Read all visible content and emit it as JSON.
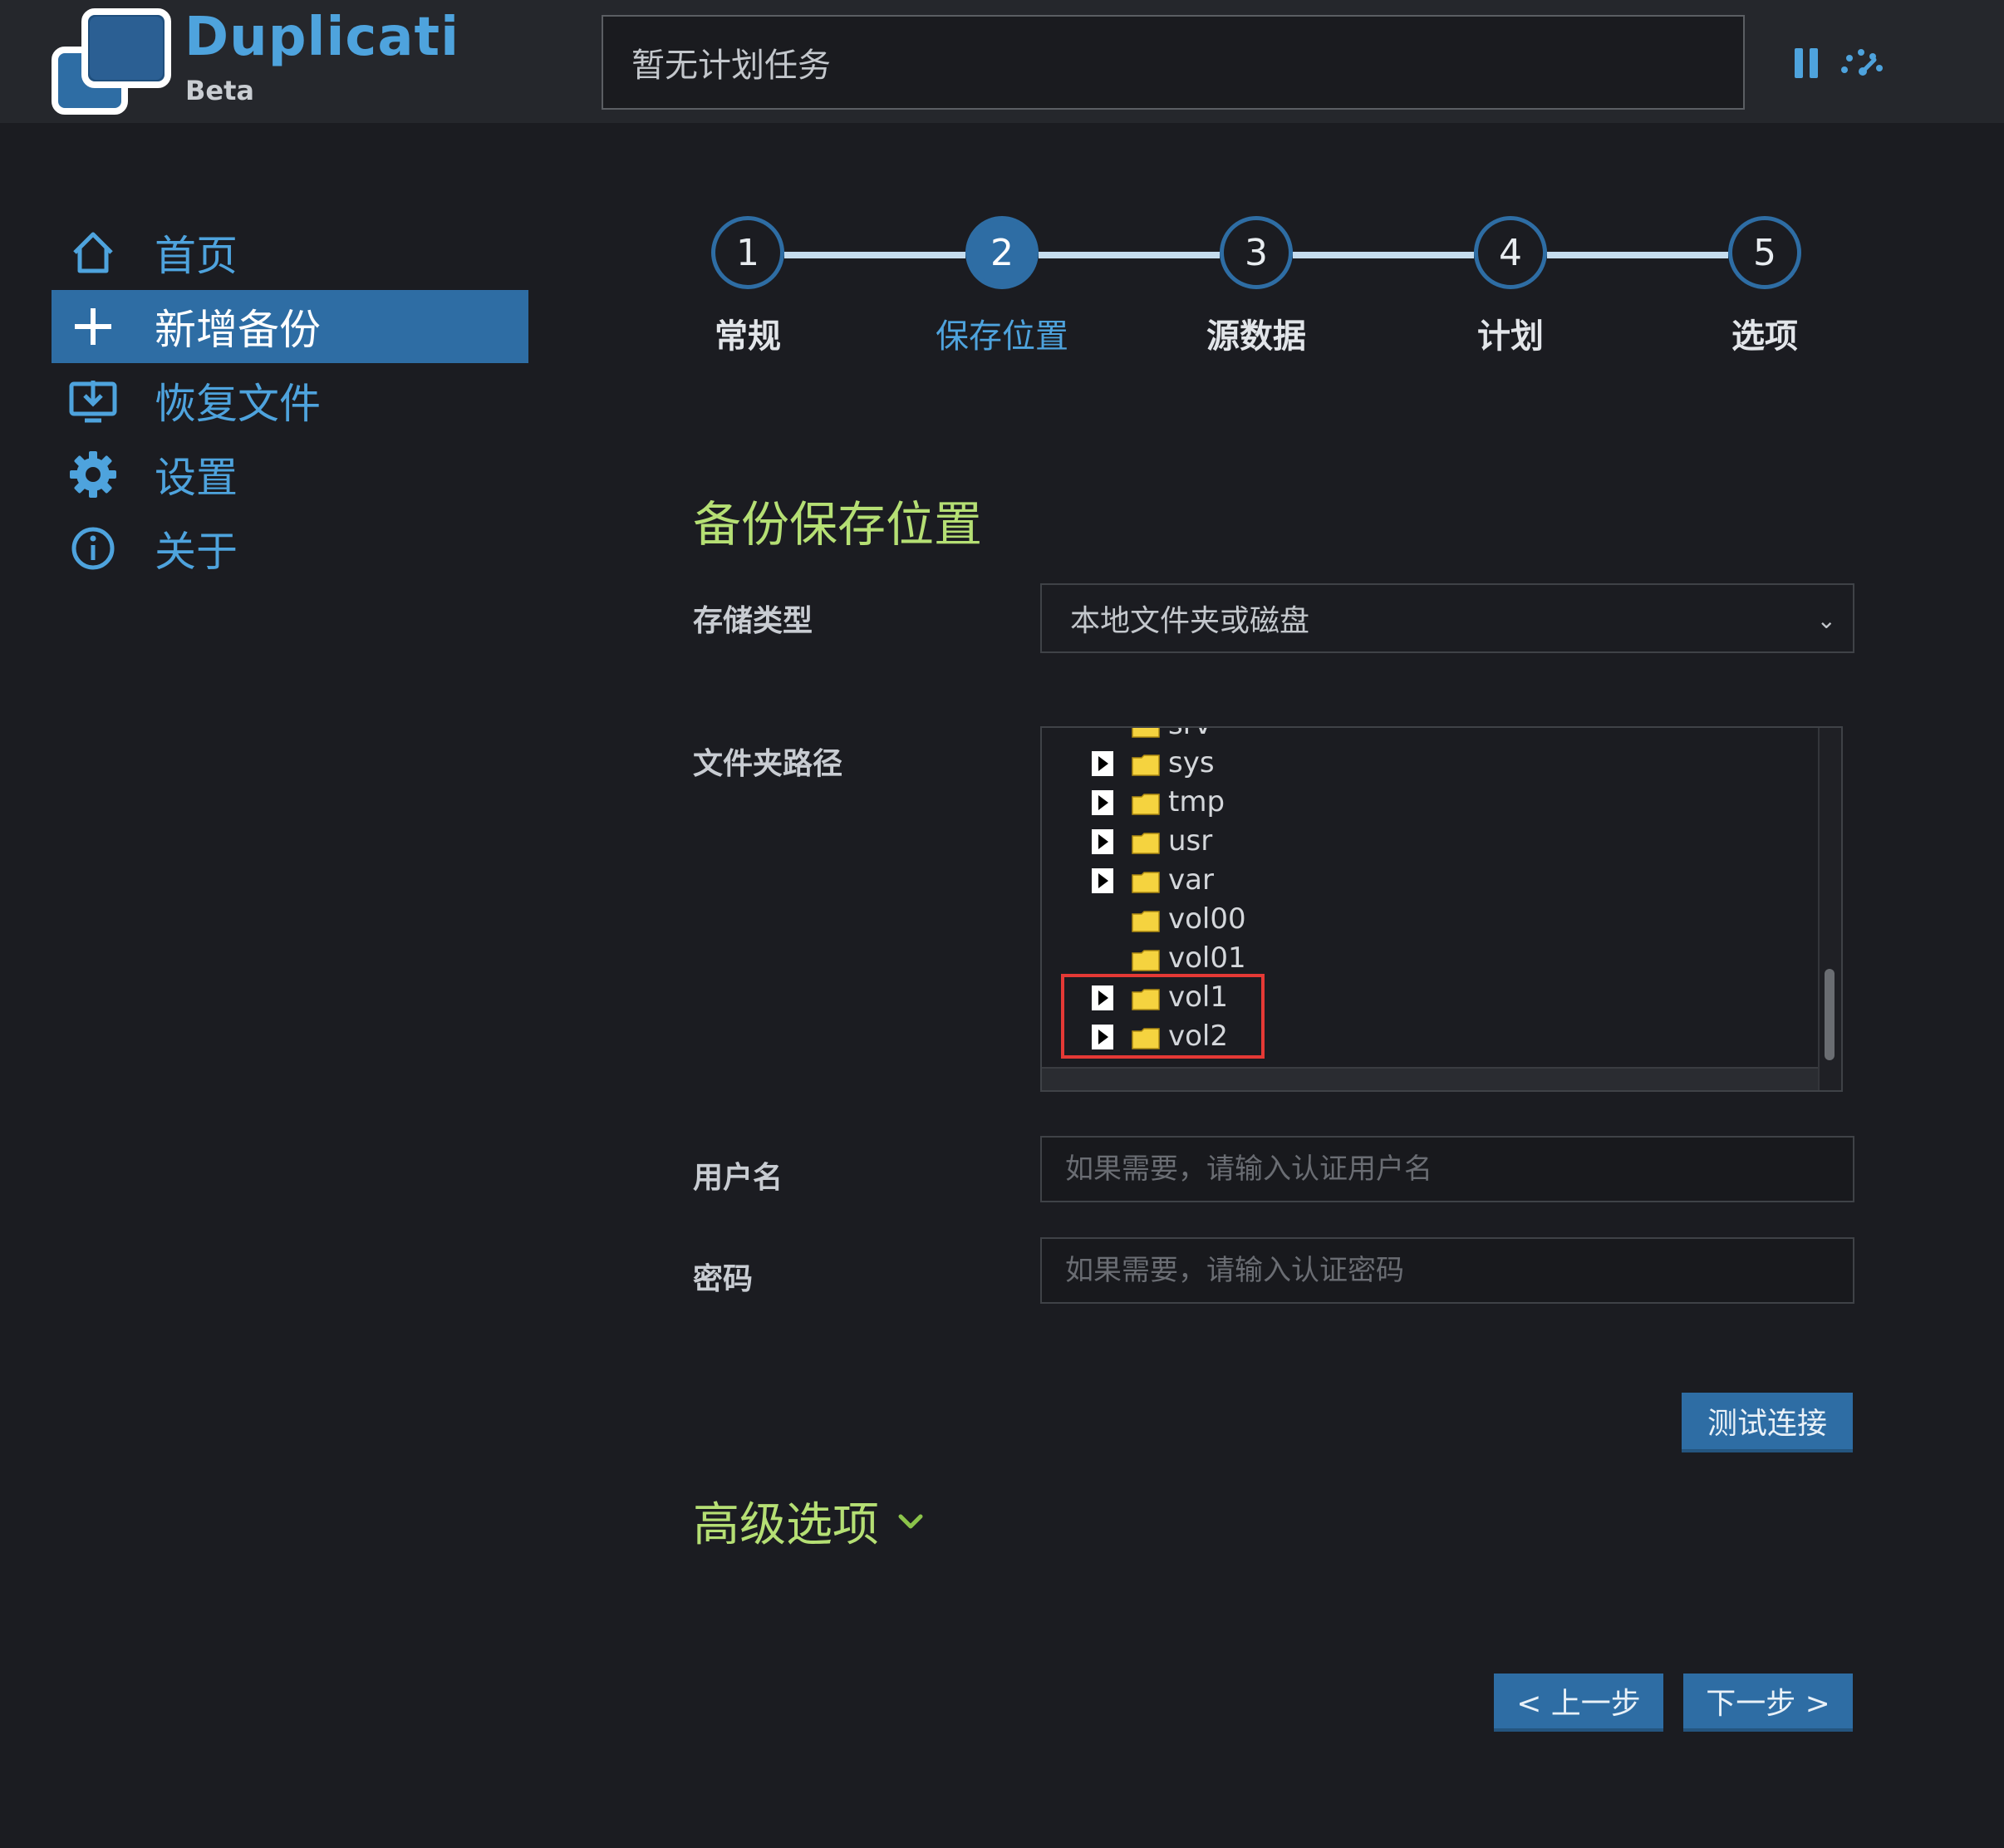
{
  "header": {
    "app_title": "Duplicati",
    "app_subtitle": "Beta",
    "status_text": "暂无计划任务",
    "icons": {
      "pause": "pause-icon",
      "throttle": "speed-gauge-icon"
    }
  },
  "sidebar": {
    "items": [
      {
        "label": "首页",
        "icon": "home-icon",
        "active": false
      },
      {
        "label": "新增备份",
        "icon": "plus-icon",
        "active": true
      },
      {
        "label": "恢复文件",
        "icon": "restore-download-icon",
        "active": false
      },
      {
        "label": "设置",
        "icon": "gear-icon",
        "active": false
      },
      {
        "label": "关于",
        "icon": "info-icon",
        "active": false
      }
    ]
  },
  "stepper": {
    "current": 2,
    "steps": [
      {
        "number": "1",
        "label": "常规"
      },
      {
        "number": "2",
        "label": "保存位置"
      },
      {
        "number": "3",
        "label": "源数据"
      },
      {
        "number": "4",
        "label": "计划"
      },
      {
        "number": "5",
        "label": "选项"
      }
    ]
  },
  "form": {
    "section_title": "备份保存位置",
    "storage_type_label": "存储类型",
    "storage_type_value": "本地文件夹或磁盘",
    "folder_path_label": "文件夹路径",
    "folder_tree": [
      {
        "name": "srv",
        "expandable": true,
        "partial": true
      },
      {
        "name": "sys",
        "expandable": true
      },
      {
        "name": "tmp",
        "expandable": true
      },
      {
        "name": "usr",
        "expandable": true
      },
      {
        "name": "var",
        "expandable": true
      },
      {
        "name": "vol00",
        "expandable": false
      },
      {
        "name": "vol01",
        "expandable": false
      },
      {
        "name": "vol1",
        "expandable": true,
        "highlighted": true
      },
      {
        "name": "vol2",
        "expandable": true,
        "highlighted": true
      }
    ],
    "username_label": "用户名",
    "username_placeholder": "如果需要，请输入认证用户名",
    "password_label": "密码",
    "password_placeholder": "如果需要，请输入认证密码",
    "test_connection_label": "测试连接",
    "advanced_options_label": "高级选项"
  },
  "footer": {
    "prev_label": "< 上一步",
    "next_label": "下一步 >"
  },
  "colors": {
    "accent": "#2e6da4",
    "accent_text": "#4ea3dd",
    "section_title": "#b5df74",
    "highlight_border": "#e53935"
  }
}
